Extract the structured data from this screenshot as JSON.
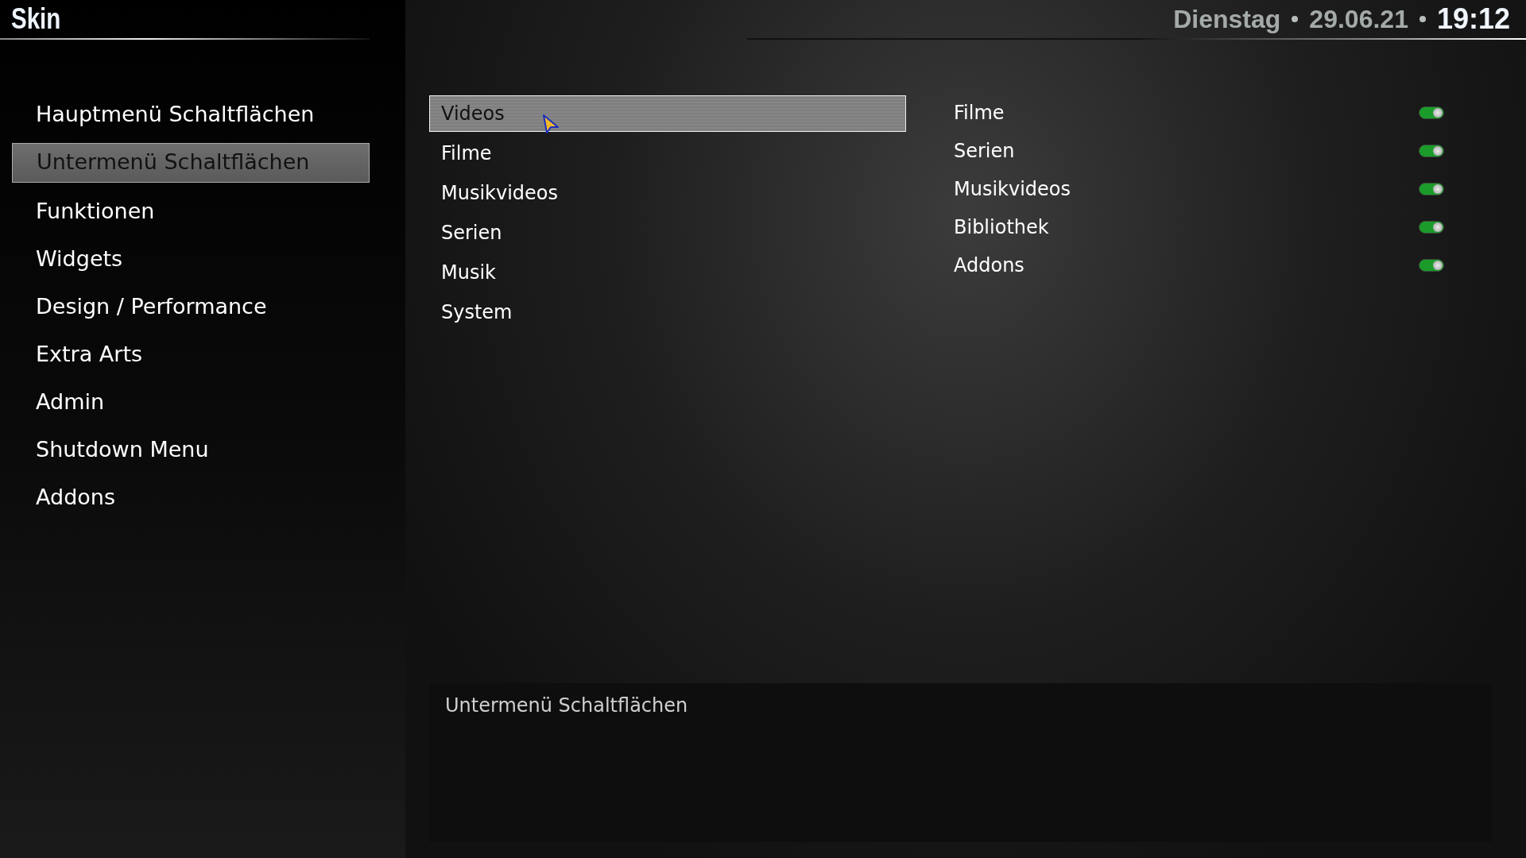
{
  "header": {
    "title": "Skin",
    "day": "Dienstag",
    "date": "29.06.21",
    "time": "19:12"
  },
  "sidebar": {
    "items": [
      {
        "label": "Hauptmenü Schaltflächen",
        "selected": false
      },
      {
        "label": "Untermenü Schaltflächen",
        "selected": true
      },
      {
        "label": "Funktionen",
        "selected": false
      },
      {
        "label": "Widgets",
        "selected": false
      },
      {
        "label": "Design / Performance",
        "selected": false
      },
      {
        "label": "Extra Arts",
        "selected": false
      },
      {
        "label": "Admin",
        "selected": false
      },
      {
        "label": "Shutdown Menu",
        "selected": false
      },
      {
        "label": "Addons",
        "selected": false
      }
    ]
  },
  "menu_list": {
    "items": [
      {
        "label": "Videos",
        "selected": true
      },
      {
        "label": "Filme",
        "selected": false
      },
      {
        "label": "Musikvideos",
        "selected": false
      },
      {
        "label": "Serien",
        "selected": false
      },
      {
        "label": "Musik",
        "selected": false
      },
      {
        "label": "System",
        "selected": false
      }
    ]
  },
  "options": {
    "items": [
      {
        "label": "Filme",
        "on": true
      },
      {
        "label": "Serien",
        "on": true
      },
      {
        "label": "Musikvideos",
        "on": true
      },
      {
        "label": "Bibliothek",
        "on": true
      },
      {
        "label": "Addons",
        "on": true
      }
    ]
  },
  "description": {
    "text": "Untermenü Schaltflächen"
  }
}
